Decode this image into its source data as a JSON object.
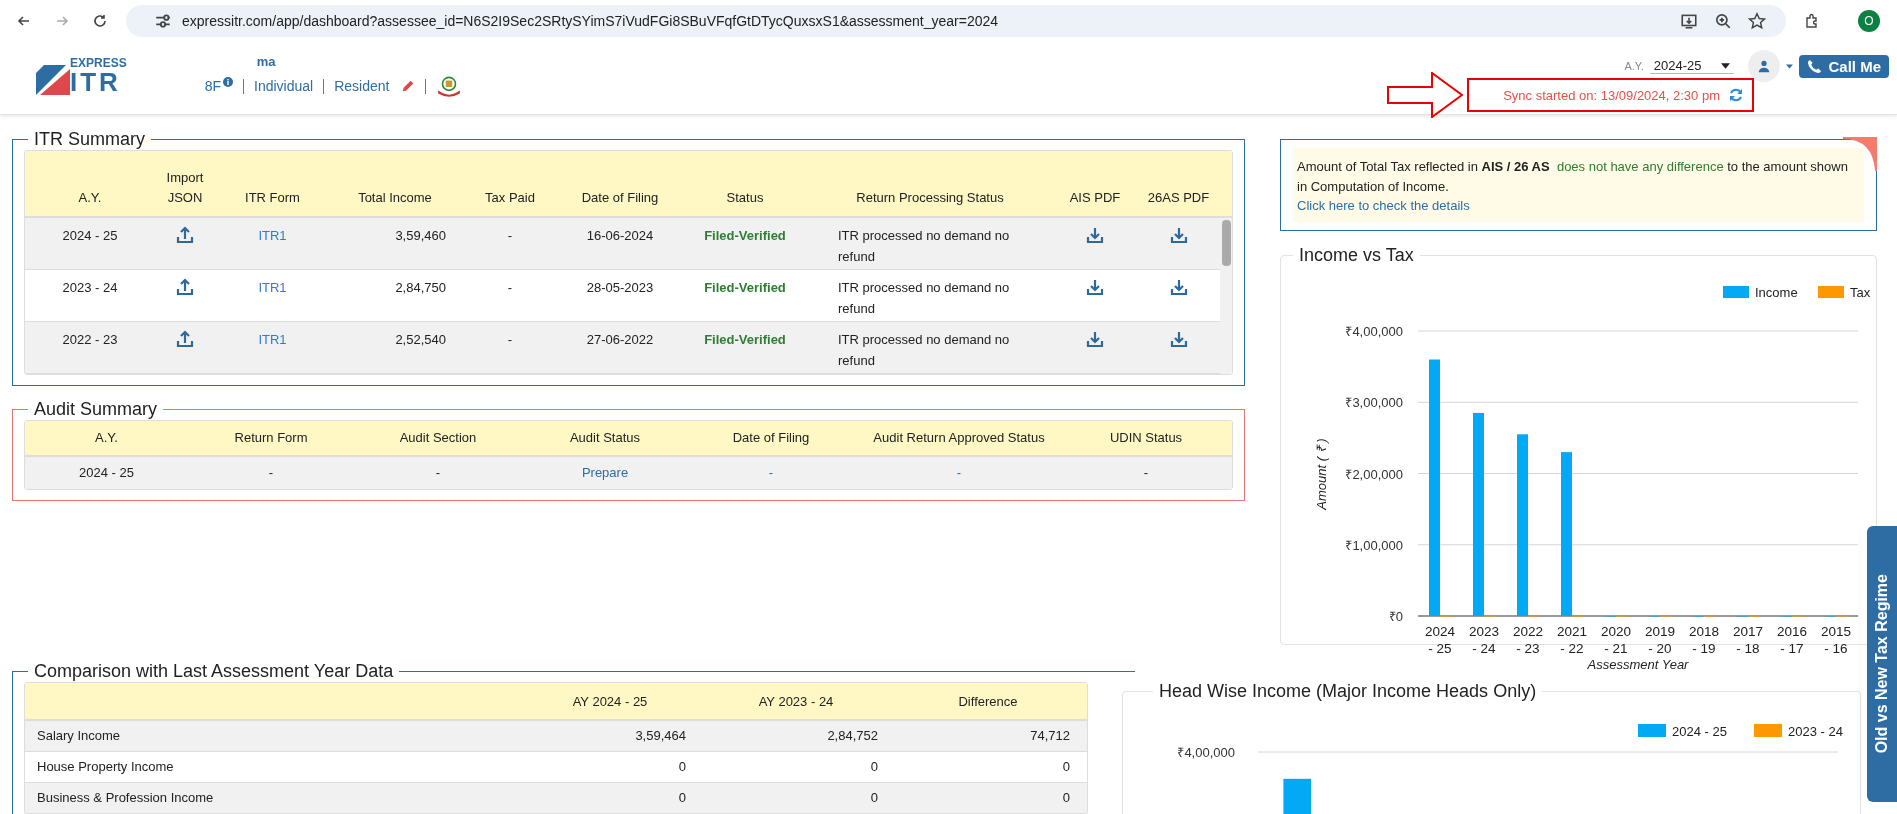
{
  "browser": {
    "url": "expressitr.com/app/dashboard?assessee_id=N6S2I9Sec2SRtySYimS7iVudFGi8SBuVFqfGtDTycQuxsxS1&assessment_year=2024",
    "profile_initial": "O"
  },
  "header": {
    "logo_top": "EXPRESS",
    "logo_main": "ITR",
    "name": "ma",
    "code": "8F",
    "type": "Individual",
    "residency": "Resident",
    "ay_label": "A.Y.",
    "ay_value": "2024-25",
    "call_button": "Call Me",
    "sync_text": "Sync started on: 13/09/2024, 2:30 pm"
  },
  "itr_summary": {
    "title": "ITR Summary",
    "columns": [
      "A.Y.",
      "Import JSON",
      "ITR Form",
      "Total Income",
      "Tax Paid",
      "Date of Filing",
      "Status",
      "Return Processing Status",
      "AIS PDF",
      "26AS PDF"
    ],
    "rows": [
      {
        "ay": "2024 - 25",
        "itr_form": "ITR1",
        "total_income": "3,59,460",
        "tax_paid": "-",
        "date": "16-06-2024",
        "status": "Filed-Verified",
        "processing": "ITR processed no demand no refund"
      },
      {
        "ay": "2023 - 24",
        "itr_form": "ITR1",
        "total_income": "2,84,750",
        "tax_paid": "-",
        "date": "28-05-2023",
        "status": "Filed-Verified",
        "processing": "ITR processed no demand no refund"
      },
      {
        "ay": "2022 - 23",
        "itr_form": "ITR1",
        "total_income": "2,52,540",
        "tax_paid": "-",
        "date": "27-06-2022",
        "status": "Filed-Verified",
        "processing": "ITR processed no demand no refund"
      }
    ]
  },
  "audit_summary": {
    "title": "Audit Summary",
    "columns": [
      "A.Y.",
      "Return Form",
      "Audit Section",
      "Audit Status",
      "Date of Filing",
      "Audit Return Approved Status",
      "UDIN Status"
    ],
    "rows": [
      {
        "ay": "2024 - 25",
        "return_form": "-",
        "audit_section": "-",
        "audit_status": "Prepare",
        "date": "-",
        "approved_status": "-",
        "udin_status": "-"
      }
    ]
  },
  "comparison": {
    "title": "Comparison with Last Assessment Year Data",
    "columns": [
      "AY 2024 - 25",
      "AY 2023 - 24",
      "Difference"
    ],
    "rows": [
      {
        "label": "Salary Income",
        "values": [
          "3,59,464",
          "2,84,752",
          "74,712"
        ]
      },
      {
        "label": "House Property Income",
        "values": [
          "0",
          "0",
          "0"
        ]
      },
      {
        "label": "Business & Profession Income",
        "values": [
          "0",
          "0",
          "0"
        ]
      }
    ]
  },
  "tax_note": {
    "text_before": "Amount of Total Tax reflected in **AIS / 26 AS**",
    "highlight": "does not have any difference",
    "text_after": "to the amount shown in Computation of Income.",
    "link": "Click here to check the details"
  },
  "income_vs_tax": {
    "title": "Income vs Tax",
    "chart_data": {
      "type": "bar",
      "xlabel": "Assessment Year",
      "ylabel": "Amount ( ₹ )",
      "categories": [
        "2024 - 25",
        "2023 - 24",
        "2022 - 23",
        "2021 - 22",
        "2020 - 21",
        "2019 - 20",
        "2018 - 19",
        "2017 - 18",
        "2016 - 17",
        "2015 - 16"
      ],
      "series": [
        {
          "name": "Income",
          "color": "#03a9f4",
          "values": [
            360000,
            285000,
            255000,
            230000,
            0,
            0,
            0,
            0,
            0,
            0
          ]
        },
        {
          "name": "Tax",
          "color": "#ff9800",
          "values": [
            0,
            0,
            0,
            0,
            0,
            0,
            0,
            0,
            0,
            0
          ]
        }
      ],
      "grid": true,
      "legend": true,
      "ylim": [
        0,
        400000
      ],
      "yticks": [
        {
          "value": 0,
          "label": "₹0"
        },
        {
          "value": 100000,
          "label": "₹1,00,000"
        },
        {
          "value": 200000,
          "label": "₹2,00,000"
        },
        {
          "value": 300000,
          "label": "₹3,00,000"
        },
        {
          "value": 400000,
          "label": "₹4,00,000"
        }
      ]
    }
  },
  "head_wise_income": {
    "title": "Head Wise Income (Major Income Heads Only)",
    "chart_data": {
      "type": "bar",
      "series": [
        {
          "name": "2024 - 25",
          "color": "#03a9f4",
          "values": [
            360000
          ]
        },
        {
          "name": "2023 - 24",
          "color": "#ff9800",
          "values": [
            null
          ]
        }
      ],
      "legend": true,
      "ylim": [
        0,
        400000
      ],
      "yticks": [
        {
          "value": 400000,
          "label": "₹4,00,000"
        }
      ]
    }
  },
  "side_tab": {
    "label": "Old vs New Tax Regime"
  }
}
